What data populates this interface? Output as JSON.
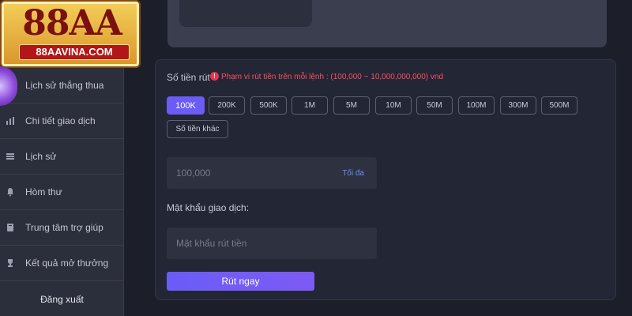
{
  "logo": {
    "main": "88AA",
    "site": "88AAVINA.COM"
  },
  "sidebar": {
    "items": [
      {
        "label": "Lịch sử thắng thua",
        "icon": "chart-icon"
      },
      {
        "label": "Chi tiết giao dịch",
        "icon": "bar-chart-icon"
      },
      {
        "label": "Lịch sử",
        "icon": "stack-icon"
      },
      {
        "label": "Hòm thư",
        "icon": "bell-icon"
      },
      {
        "label": "Trung tâm trợ giúp",
        "icon": "book-icon"
      },
      {
        "label": "Kết quả mở thưởng",
        "icon": "trophy-icon"
      }
    ],
    "logout": "Đăng xuất"
  },
  "withdraw": {
    "amount_label": "Số tiền rút",
    "range_note": "Phạm vi rút tiền trên mỗi lệnh : (100,000 ~ 10,000,000,000) vnd",
    "chips": [
      "100K",
      "200K",
      "500K",
      "1M",
      "5M",
      "10M",
      "50M",
      "100M",
      "300M",
      "500M"
    ],
    "selected_chip": "100K",
    "other_amount": "Số tiền khác",
    "amount_value": "100,000",
    "max_label": "Tối đa",
    "password_label": "Mật khẩu giao dịch:",
    "password_placeholder": "Mật khẩu rút tiền",
    "submit_label": "Rút ngay"
  },
  "colors": {
    "accent": "#6b5cf6",
    "warning": "#ff4d62",
    "link": "#6a8cff"
  }
}
